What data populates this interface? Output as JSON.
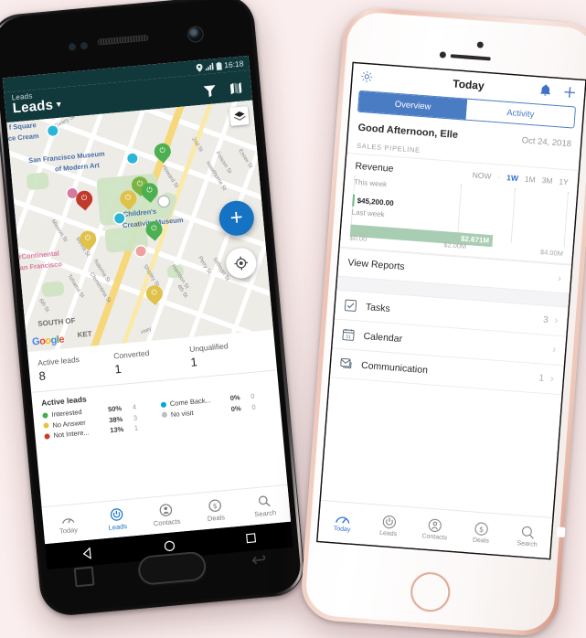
{
  "background_color": "#fbeeee",
  "android": {
    "device": "android-phone",
    "status_bar": {
      "time": "16:18",
      "icons": [
        "location-icon",
        "signal-icon",
        "battery-icon"
      ]
    },
    "app_bar": {
      "subtitle": "Leads",
      "title": "Leads",
      "dropdown_caret": "▾",
      "actions": [
        "filter-icon",
        "map-icon"
      ],
      "background_color": "#11383b"
    },
    "map": {
      "labels": [
        {
          "text": "San Francisco Museum",
          "kind": "poi"
        },
        {
          "text": "of Modern Art",
          "kind": "poi"
        },
        {
          "text": "Children's",
          "kind": "poi"
        },
        {
          "text": "Creativity Museum",
          "kind": "poi"
        },
        {
          "text": "f Square",
          "kind": "poi"
        },
        {
          "text": "ce Cream",
          "kind": "poi"
        },
        {
          "text": "rContinental",
          "kind": "hotel"
        },
        {
          "text": "an Francisco",
          "kind": "hotel"
        },
        {
          "text": "SOUTH OF",
          "kind": "area"
        },
        {
          "text": "KET",
          "kind": "area"
        },
        {
          "text": "Geary St",
          "kind": "street"
        },
        {
          "text": "Mission St",
          "kind": "street"
        },
        {
          "text": "Minna St",
          "kind": "street"
        },
        {
          "text": "Natoma St",
          "kind": "street"
        },
        {
          "text": "Howard St",
          "kind": "street"
        },
        {
          "text": "Tehama St",
          "kind": "street"
        },
        {
          "text": "Clementina St",
          "kind": "street"
        },
        {
          "text": "Folsom St",
          "kind": "street"
        },
        {
          "text": "Harrison St",
          "kind": "street"
        },
        {
          "text": "Shipley St",
          "kind": "street"
        },
        {
          "text": "Clara St",
          "kind": "street"
        },
        {
          "text": "Hawthorne St",
          "kind": "street"
        },
        {
          "text": "Essex St",
          "kind": "street"
        },
        {
          "text": "Perry St",
          "kind": "street"
        },
        {
          "text": "Stillman St",
          "kind": "street"
        },
        {
          "text": "2nd St",
          "kind": "street"
        },
        {
          "text": "3rd St",
          "kind": "street"
        },
        {
          "text": "4th St",
          "kind": "street"
        },
        {
          "text": "5th St",
          "kind": "street"
        },
        {
          "text": "6th St",
          "kind": "street"
        },
        {
          "text": "Hwy",
          "kind": "street"
        }
      ],
      "attribution": "Google",
      "fab_label": "+",
      "buttons": [
        "layers-button",
        "my-location-button",
        "add-lead-fab"
      ]
    },
    "stats": [
      {
        "label": "Active leads",
        "value": "8"
      },
      {
        "label": "Converted",
        "value": "1"
      },
      {
        "label": "Unqualified",
        "value": "1"
      }
    ],
    "legend": {
      "title": "Active leads",
      "left": [
        {
          "name": "Interested",
          "pct": "50%",
          "count": "4",
          "color": "#3faf46"
        },
        {
          "name": "No Answer",
          "pct": "38%",
          "count": "3",
          "color": "#e8c247"
        },
        {
          "name": "Not Intere...",
          "pct": "13%",
          "count": "1",
          "color": "#cf3a22"
        }
      ],
      "right": [
        {
          "name": "Come Back...",
          "pct": "0%",
          "count": "0",
          "color": "#00a6dd"
        },
        {
          "name": "No visit",
          "pct": "0%",
          "count": "0",
          "color": "#bdbdbd"
        }
      ]
    },
    "tabs": [
      {
        "label": "Today",
        "icon": "speedometer-icon",
        "active": false
      },
      {
        "label": "Leads",
        "icon": "leads-icon",
        "active": true
      },
      {
        "label": "Contacts",
        "icon": "contacts-icon",
        "active": false
      },
      {
        "label": "Deals",
        "icon": "dollar-icon",
        "active": false
      },
      {
        "label": "Search",
        "icon": "search-icon",
        "active": false
      }
    ],
    "soft_nav": [
      "back-triangle-icon",
      "home-circle-icon",
      "recents-square-icon"
    ],
    "accent_color": "#1673c4"
  },
  "iphone": {
    "device": "iphone-rose-gold",
    "nav": {
      "title": "Today",
      "left_icon": "gear-icon",
      "right_icons": [
        "bell-icon",
        "plus-icon"
      ]
    },
    "segments": [
      {
        "label": "Overview",
        "active": true
      },
      {
        "label": "Activity",
        "active": false
      }
    ],
    "greeting": "Good Afternoon, Elle",
    "date": "Oct 24, 2018",
    "section_label": "SALES PIPELINE",
    "revenue": {
      "title": "Revenue",
      "ranges": [
        {
          "label": "NOW",
          "active": false
        },
        {
          "label": "·",
          "active": false
        },
        {
          "label": "1W",
          "active": true
        },
        {
          "label": "1M",
          "active": false
        },
        {
          "label": "3M",
          "active": false
        },
        {
          "label": "1Y",
          "active": false
        }
      ]
    },
    "view_reports": "View Reports",
    "list": [
      {
        "label": "Tasks",
        "count": "3",
        "icon": "checkbox-icon"
      },
      {
        "label": "Calendar",
        "count": "",
        "icon": "calendar-icon"
      },
      {
        "label": "Communication",
        "count": "1",
        "icon": "message-icon"
      }
    ],
    "tabs": [
      {
        "label": "Today",
        "icon": "speedometer-icon",
        "active": true
      },
      {
        "label": "Leads",
        "icon": "leads-icon",
        "active": false
      },
      {
        "label": "Contacts",
        "icon": "contacts-icon",
        "active": false
      },
      {
        "label": "Deals",
        "icon": "dollar-icon",
        "active": false
      },
      {
        "label": "Search",
        "icon": "search-icon",
        "active": false
      }
    ],
    "accent_color": "#4a7cc4"
  },
  "chart_data": {
    "type": "bar",
    "title": "Revenue",
    "categories": [
      "This week",
      "Last week"
    ],
    "values": [
      45200,
      2671000
    ],
    "value_labels": [
      "$45,200.00",
      "$2.671M"
    ],
    "xlabel": "",
    "ylabel": "",
    "xlim": [
      0,
      4000000
    ],
    "xticks": [
      0,
      2000000,
      4000000
    ],
    "xtick_labels": [
      "$0.00",
      "$2.00M",
      "$4.00M"
    ],
    "grid": true,
    "orientation": "horizontal",
    "bar_color": "#a9cdb3",
    "legend": "none",
    "range_selected": "1W"
  }
}
